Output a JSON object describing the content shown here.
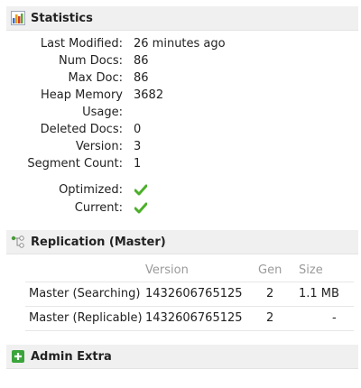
{
  "statistics": {
    "title": "Statistics",
    "icon": "bar-chart-icon",
    "rows": [
      {
        "label": "Last Modified:",
        "value": "26 minutes ago"
      },
      {
        "label": "Num Docs:",
        "value": "86"
      },
      {
        "label": "Max Doc:",
        "value": "86"
      },
      {
        "label": "Heap Memory",
        "value": "3682"
      },
      {
        "label": "Usage:",
        "value": ""
      },
      {
        "label": "Deleted Docs:",
        "value": "0"
      },
      {
        "label": "Version:",
        "value": "3"
      },
      {
        "label": "Segment Count:",
        "value": "1"
      }
    ],
    "flags": [
      {
        "label": "Optimized:",
        "value": true
      },
      {
        "label": "Current:",
        "value": true
      }
    ],
    "check_color": "#4caf2a"
  },
  "replication": {
    "title": "Replication (Master)",
    "icon": "replication-icon",
    "columns": {
      "version": "Version",
      "gen": "Gen",
      "size": "Size"
    },
    "rows": [
      {
        "name": "Master (Searching)",
        "version": "1432606765125",
        "gen": "2",
        "size": "1.1 MB"
      },
      {
        "name": "Master (Replicable)",
        "version": "1432606765125",
        "gen": "2",
        "size": "-"
      }
    ]
  },
  "admin_extra": {
    "title": "Admin Extra",
    "icon": "plus-icon",
    "icon_color": "#3aa53a"
  }
}
